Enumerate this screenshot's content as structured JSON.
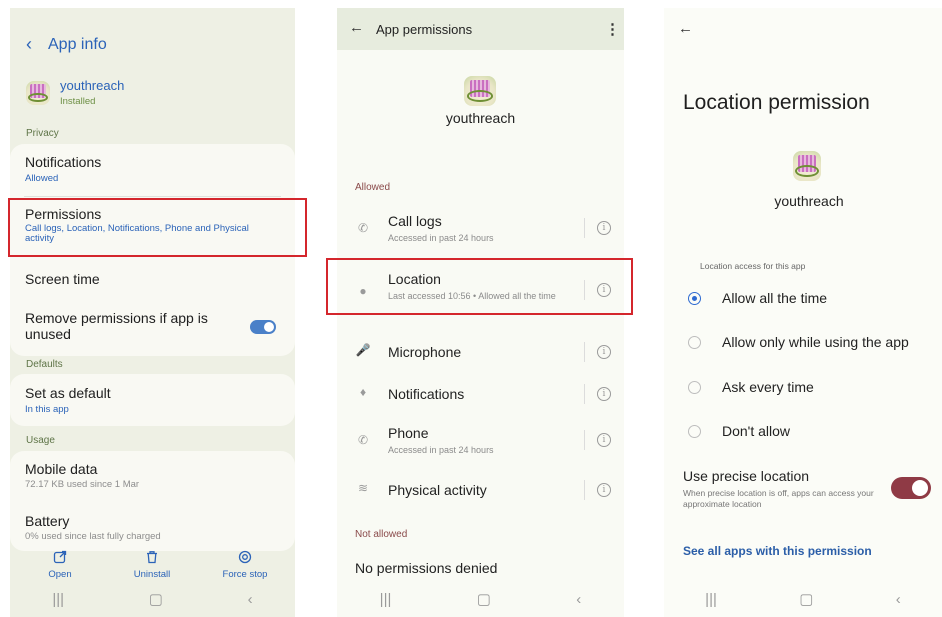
{
  "panel1": {
    "header_title": "App info",
    "app_name": "youthreach",
    "app_status": "Installed",
    "section_privacy": "Privacy",
    "notifications": {
      "title": "Notifications",
      "sub": "Allowed"
    },
    "permissions": {
      "title": "Permissions",
      "sub": "Call logs, Location, Notifications, Phone and Physical activity"
    },
    "screen_time": "Screen time",
    "remove_permissions": {
      "title": "Remove permissions if app is unused",
      "enabled": true
    },
    "section_defaults": "Defaults",
    "set_as_default": {
      "title": "Set as default",
      "sub": "In this app"
    },
    "section_usage": "Usage",
    "mobile_data": {
      "title": "Mobile data",
      "sub": "72.17 KB used since 1 Mar"
    },
    "battery": {
      "title": "Battery",
      "sub": "0% used since last fully charged"
    },
    "actions": {
      "open": "Open",
      "uninstall": "Uninstall",
      "force_stop": "Force stop"
    }
  },
  "panel2": {
    "header_title": "App permissions",
    "app_name": "youthreach",
    "section_allowed": "Allowed",
    "allowed": [
      {
        "icon": "call-log-icon",
        "title": "Call logs",
        "sub": "Accessed in past 24 hours"
      },
      {
        "icon": "location-pin-icon",
        "title": "Location",
        "sub": "Last accessed 10:56 • Allowed all the time"
      },
      {
        "icon": "microphone-icon",
        "title": "Microphone",
        "sub": ""
      },
      {
        "icon": "bell-icon",
        "title": "Notifications",
        "sub": ""
      },
      {
        "icon": "phone-icon",
        "title": "Phone",
        "sub": "Accessed in past 24 hours"
      },
      {
        "icon": "running-person-icon",
        "title": "Physical activity",
        "sub": ""
      }
    ],
    "section_not_allowed": "Not allowed",
    "no_denied": "No permissions denied"
  },
  "panel3": {
    "header_title": "Location permission",
    "app_name": "youthreach",
    "section_label": "Location access for this app",
    "options": [
      {
        "label": "Allow all the time",
        "selected": true
      },
      {
        "label": "Allow only while using the app",
        "selected": false
      },
      {
        "label": "Ask every time",
        "selected": false
      },
      {
        "label": "Don't allow",
        "selected": false
      }
    ],
    "precise": {
      "title": "Use precise location",
      "sub": "When precise location is off, apps can access your approximate location",
      "enabled": true
    },
    "see_all_link": "See all apps with this permission"
  },
  "colors": {
    "accent_blue": "#2b63b8",
    "highlight_red": "#d4262c",
    "toggle_maroon": "#8f3a45",
    "section_green": "#5f7548"
  }
}
